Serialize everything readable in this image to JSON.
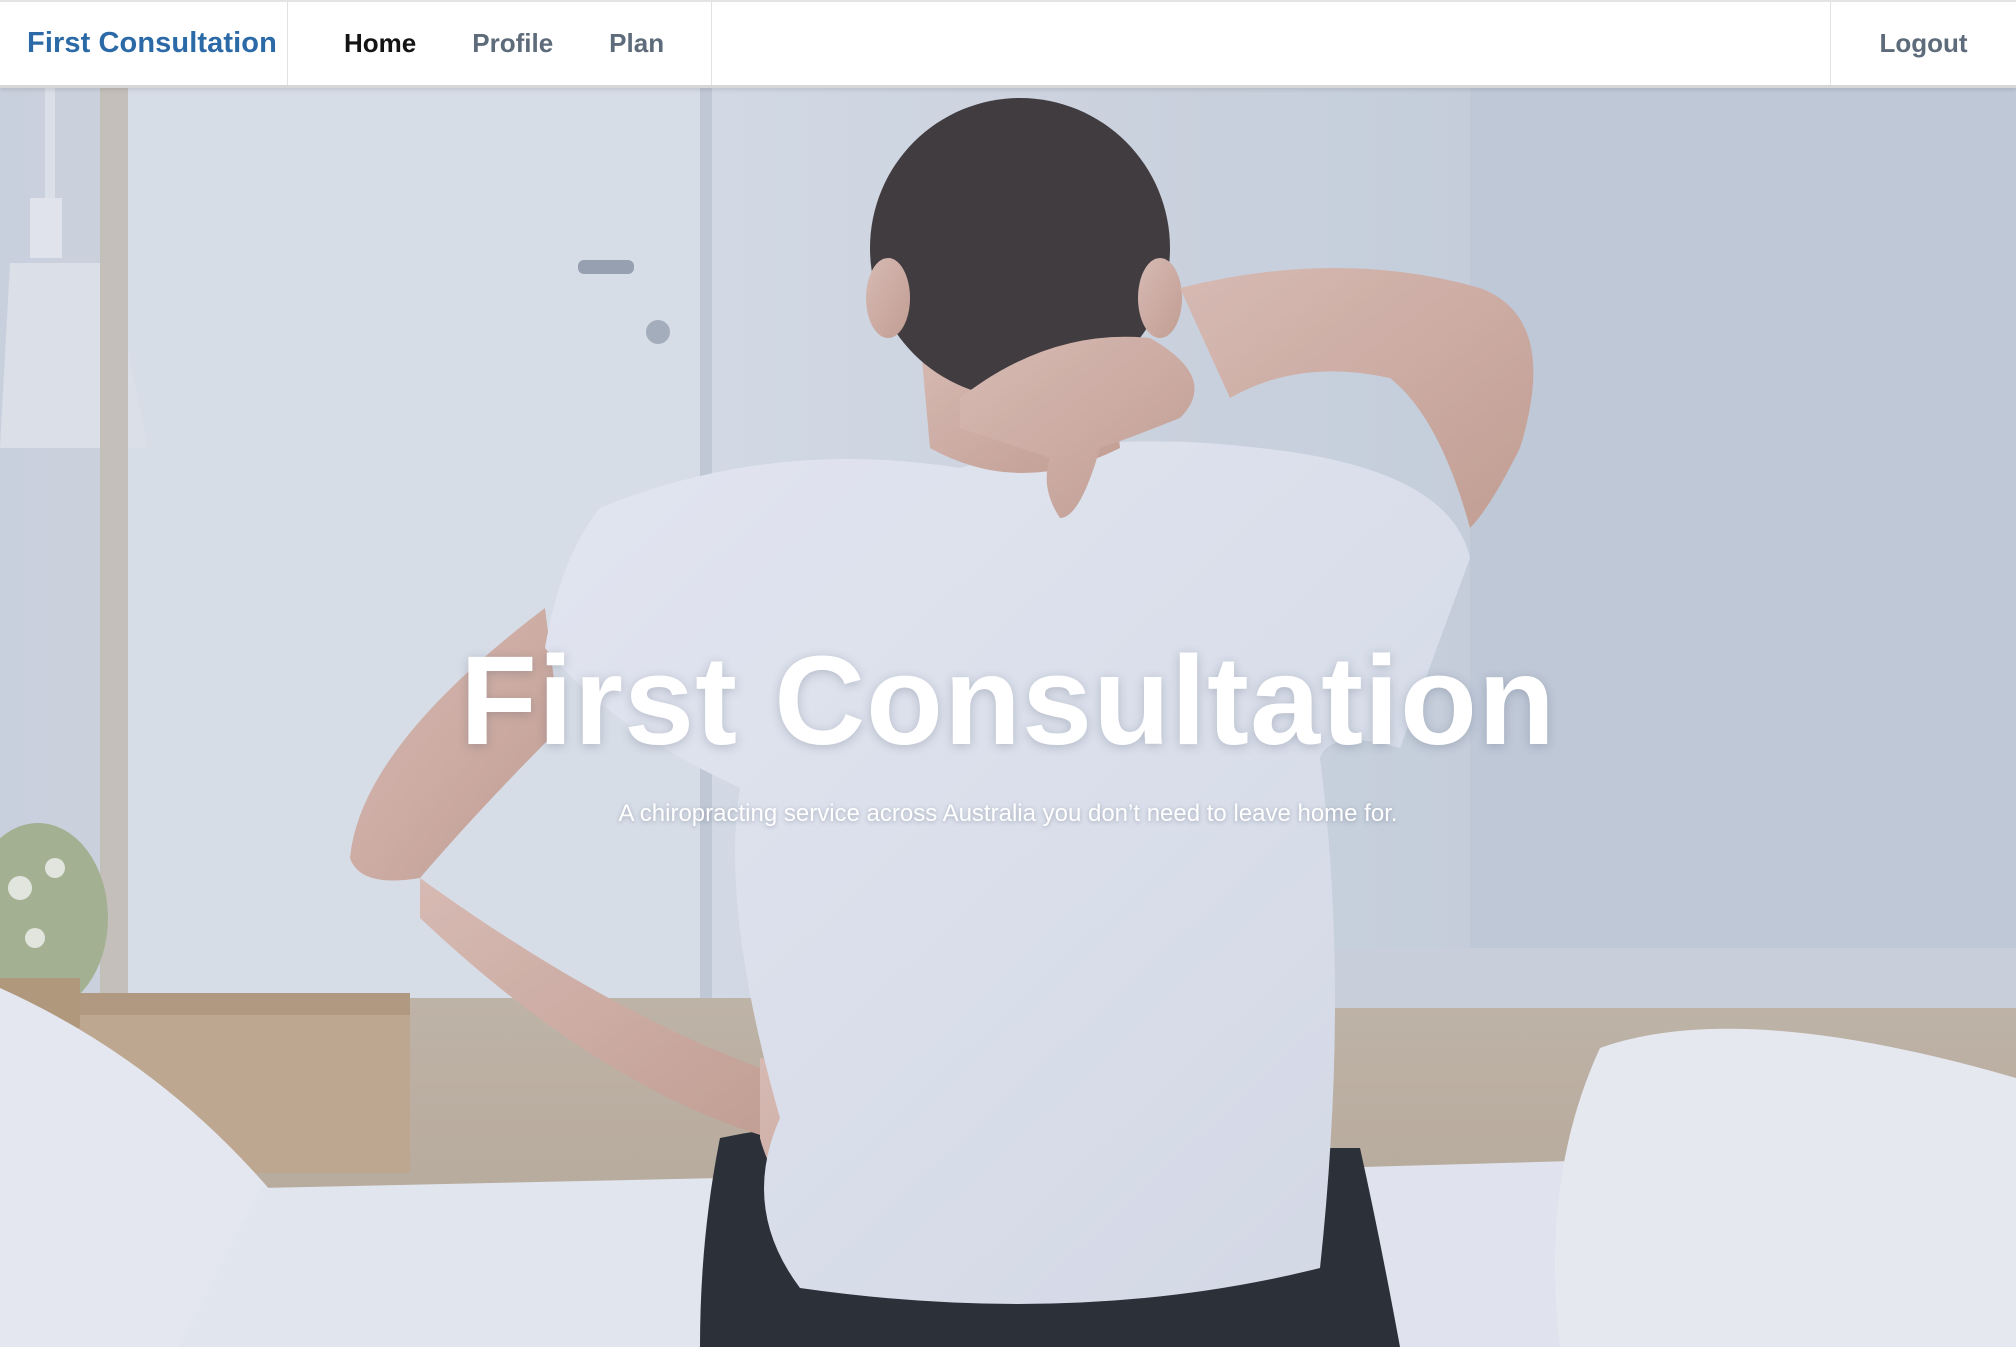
{
  "navbar": {
    "brand": "First Consultation",
    "links": [
      {
        "label": "Home",
        "active": true
      },
      {
        "label": "Profile",
        "active": false
      },
      {
        "label": "Plan",
        "active": false
      }
    ],
    "logout_label": "Logout"
  },
  "hero": {
    "title": "First Consultation",
    "subtitle": "A chiropracting service across Australia you don’t need to leave home for.",
    "image": "man-with-back-and-neck-pain-sitting-on-bed"
  },
  "colors": {
    "brand": "#2b6aa6",
    "nav_text": "#5d6b7a",
    "nav_active": "#141414"
  }
}
